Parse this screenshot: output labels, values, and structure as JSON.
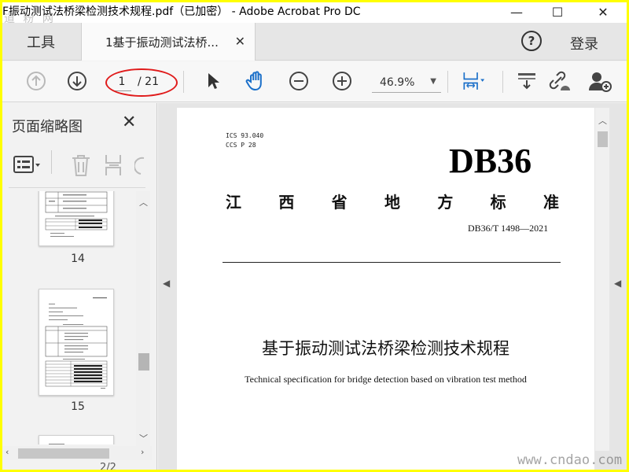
{
  "window": {
    "title": "F振动测试法桥梁检测技术规程.pdf（已加密） - Adobe Acrobat Pro DC",
    "watermark_top": "道 粉 网",
    "minimize": "—",
    "maximize": "☐",
    "close": "✕"
  },
  "tabs": {
    "tools": "工具",
    "document": "1基于振动测试法桥...",
    "document_close": "✕",
    "help": "?",
    "login": "登录"
  },
  "toolbar": {
    "current_page": "1",
    "total_pages": "/ 21",
    "zoom": "46.9%",
    "highlight_color": "#e01b1b",
    "accent_color": "#1a6fc9"
  },
  "sidebar": {
    "title": "页面缩略图",
    "close": "✕",
    "thumbnails": [
      {
        "label": "14"
      },
      {
        "label": "15"
      }
    ],
    "page_counter": "2/2"
  },
  "document": {
    "ics_line1": "ICS 93.040",
    "ics_line2": "CCS P 28",
    "code": "DB36",
    "province_chars": [
      "江",
      "西",
      "省",
      "地",
      "方",
      "标",
      "准"
    ],
    "standard_number": "DB36/T 1498—2021",
    "title_zh": "基于振动测试法桥梁检测技术规程",
    "title_en": "Technical specification for bridge detection based on vibration test method",
    "watermark": "www.cndao.com"
  }
}
